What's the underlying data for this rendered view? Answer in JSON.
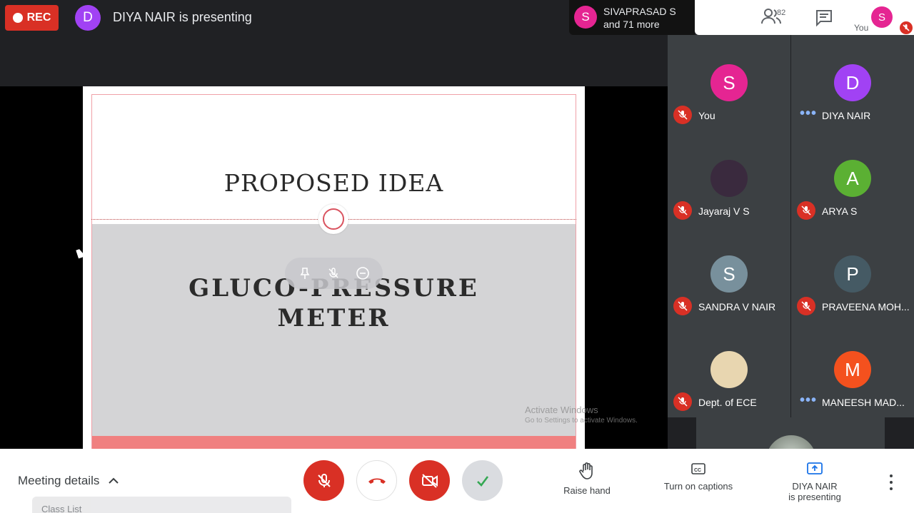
{
  "top_bar": {
    "rec_label": "REC",
    "presenter_initial": "D",
    "presenting_text": "DIYA NAIR is presenting"
  },
  "active_speaker": {
    "initial": "S",
    "line1": "SIVAPRASAD S",
    "line2": "and 71 more"
  },
  "top_controls": {
    "people_icon": "people-icon",
    "people_count": "82",
    "chat_icon": "chat-icon",
    "self_label": "You",
    "self_initial": "S"
  },
  "slide": {
    "title": "PROPOSED IDEA",
    "subtitle_line1": "GLUCO-PRESSURE",
    "subtitle_line2": "METER"
  },
  "watermark": {
    "line1": "Activate Windows",
    "line2": "Go to Settings to activate Windows."
  },
  "participants": [
    {
      "initial": "S",
      "name": "You",
      "color": "#e52592",
      "muted": true
    },
    {
      "initial": "D",
      "name": "DIYA NAIR",
      "color": "#a142f4",
      "muted": false
    },
    {
      "initial": "",
      "name": "Jayaraj V S",
      "color": "#3a2a3e",
      "muted": true
    },
    {
      "initial": "A",
      "name": "ARYA S",
      "color": "#5bb033",
      "muted": true
    },
    {
      "initial": "S",
      "name": "SANDRA V NAIR",
      "color": "#78909c",
      "muted": true
    },
    {
      "initial": "P",
      "name": "PRAVEENA MOH...",
      "color": "#455a64",
      "muted": true
    },
    {
      "initial": "",
      "name": "Dept. of ECE",
      "color": "#e8d6b0",
      "muted": true
    },
    {
      "initial": "M",
      "name": "MANEESH MAD...",
      "color": "#f4511e",
      "muted": false
    }
  ],
  "bottom_bar": {
    "meeting_details": "Meeting details",
    "ghost_toolbar_text": "Class List",
    "raise_hand": "Raise hand",
    "captions": "Turn on captions",
    "present_line1": "DIYA NAIR",
    "present_line2": "is presenting"
  }
}
